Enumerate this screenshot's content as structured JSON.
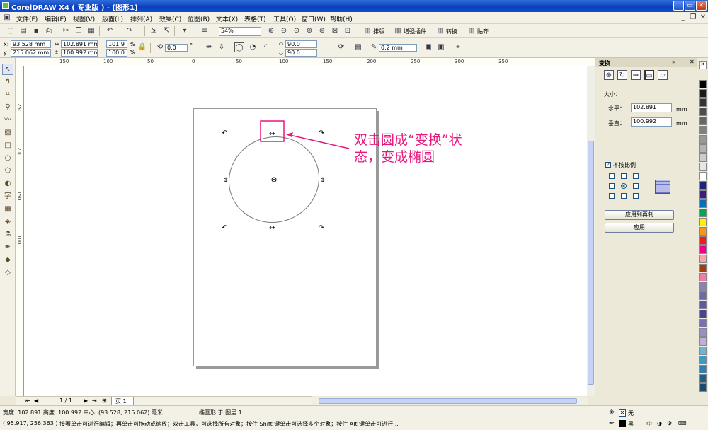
{
  "window": {
    "title": "CorelDRAW X4 ( 专业版 ) - [图形1]"
  },
  "menu": [
    "文件(F)",
    "编辑(E)",
    "视图(V)",
    "版面(L)",
    "排列(A)",
    "效果(C)",
    "位图(B)",
    "文本(X)",
    "表格(T)",
    "工具(O)",
    "窗口(W)",
    "帮助(H)"
  ],
  "toolbar1": {
    "zoom": "54%",
    "plugins": [
      "排版",
      "增强插件",
      "转换",
      "贴齐"
    ]
  },
  "property_bar": {
    "x": "93.528 mm",
    "y": "215.062 mm",
    "width": "102.891 mm",
    "height": "100.992 mm",
    "scale_x": "101.9",
    "scale_y": "100.0",
    "percent": "%",
    "rotation": "0.0",
    "degree": "°",
    "angle_start": "90.0",
    "angle_end": "90.0",
    "outline_width": "0.2 mm",
    "x_label": "x:",
    "y_label": "y:"
  },
  "ruler_h": [
    "150",
    "100",
    "50",
    "0",
    "50",
    "100",
    "150",
    "200",
    "250",
    "300",
    "350"
  ],
  "ruler_v": [
    "250",
    "200",
    "150",
    "100"
  ],
  "annotation": {
    "line1": "双击圆成“变换”状",
    "line2": "态，变成椭圆"
  },
  "docker": {
    "title": "变换",
    "size_label": "大小：",
    "horizontal_label": "水平：",
    "horizontal_value": "102.891",
    "vertical_label": "垂直：",
    "vertical_value": "100.992",
    "unit": "mm",
    "nonprop_label": "不按比例",
    "apply_copy": "应用到再制",
    "apply": "应用"
  },
  "page_nav": {
    "count": "1 / 1",
    "tab": "页 1"
  },
  "status": {
    "line1a": "宽度: 102.891  高度: 100.992  中心: (93.528, 215.062)  毫米",
    "line1b": "椭圆形 于 图层 1",
    "line2a": "( 95.917, 256.363 )",
    "line2b": "接著单击可进行编辑；再单击可拖动或缩放；双击工具，可选择所有对象；按住 Shift 键单击可选择多个对象；按住 Alt 键单击可进行...",
    "fill_label": "无",
    "outline_label": "黑",
    "ime": "中"
  },
  "colors": {
    "annotation": "#e8177d",
    "accent": "#0a3fbd"
  }
}
